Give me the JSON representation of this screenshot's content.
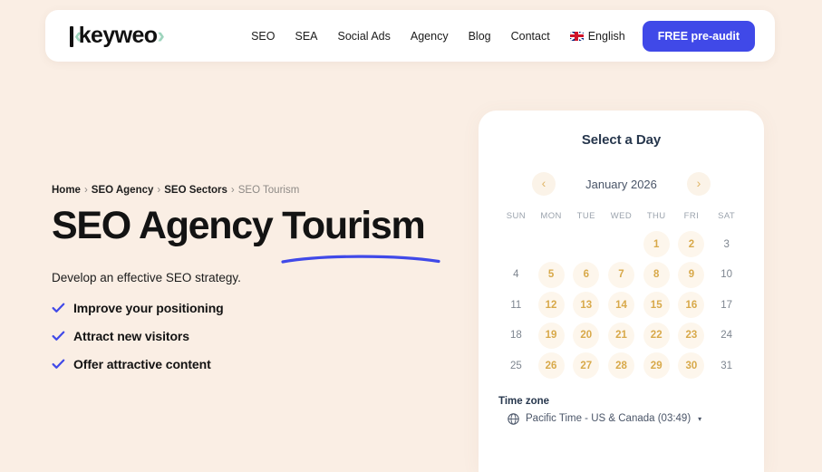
{
  "header": {
    "logo": {
      "text": "keyweo",
      "chevron_left": "‹",
      "chevron_right": "›"
    },
    "nav_items": [
      {
        "label": "SEO"
      },
      {
        "label": "SEA"
      },
      {
        "label": "Social Ads"
      },
      {
        "label": "Agency"
      },
      {
        "label": "Blog"
      },
      {
        "label": "Contact"
      }
    ],
    "language": {
      "label": "English",
      "flag": "uk-flag-icon"
    },
    "cta": {
      "label_strong": "FREE",
      "label_rest": " pre-audit",
      "color": "#4049e8"
    }
  },
  "breadcrumb": {
    "items": [
      {
        "label": "Home",
        "current": false
      },
      {
        "label": "SEO Agency",
        "current": false
      },
      {
        "label": "SEO Sectors",
        "current": false
      },
      {
        "label": "SEO Tourism",
        "current": true
      }
    ],
    "separator": "›"
  },
  "hero": {
    "title": "SEO Agency Tourism",
    "underline_color": "#4049e8",
    "subtitle": "Develop an effective SEO strategy.",
    "features": [
      {
        "label": "Improve your positioning"
      },
      {
        "label": "Attract new visitors"
      },
      {
        "label": "Offer attractive content"
      }
    ],
    "check_color": "#4049e8"
  },
  "calendar": {
    "title": "Select a Day",
    "prev_label": "‹",
    "next_label": "›",
    "month": "January 2026",
    "weekdays": [
      "SUN",
      "MON",
      "TUE",
      "WED",
      "THU",
      "FRI",
      "SAT"
    ],
    "available_color": "#d8a94a",
    "available_bg": "#fdf6ec",
    "weeks": [
      [
        {
          "label": "",
          "available": false,
          "blank": true
        },
        {
          "label": "",
          "available": false,
          "blank": true
        },
        {
          "label": "",
          "available": false,
          "blank": true
        },
        {
          "label": "",
          "available": false,
          "blank": true
        },
        {
          "label": "1",
          "available": true,
          "blank": false
        },
        {
          "label": "2",
          "available": true,
          "blank": false
        },
        {
          "label": "3",
          "available": false,
          "blank": false
        }
      ],
      [
        {
          "label": "4",
          "available": false,
          "blank": false
        },
        {
          "label": "5",
          "available": true,
          "blank": false
        },
        {
          "label": "6",
          "available": true,
          "blank": false
        },
        {
          "label": "7",
          "available": true,
          "blank": false
        },
        {
          "label": "8",
          "available": true,
          "blank": false
        },
        {
          "label": "9",
          "available": true,
          "blank": false
        },
        {
          "label": "10",
          "available": false,
          "blank": false
        }
      ],
      [
        {
          "label": "11",
          "available": false,
          "blank": false
        },
        {
          "label": "12",
          "available": true,
          "blank": false
        },
        {
          "label": "13",
          "available": true,
          "blank": false
        },
        {
          "label": "14",
          "available": true,
          "blank": false
        },
        {
          "label": "15",
          "available": true,
          "blank": false
        },
        {
          "label": "16",
          "available": true,
          "blank": false
        },
        {
          "label": "17",
          "available": false,
          "blank": false
        }
      ],
      [
        {
          "label": "18",
          "available": false,
          "blank": false
        },
        {
          "label": "19",
          "available": true,
          "blank": false
        },
        {
          "label": "20",
          "available": true,
          "blank": false
        },
        {
          "label": "21",
          "available": true,
          "blank": false
        },
        {
          "label": "22",
          "available": true,
          "blank": false
        },
        {
          "label": "23",
          "available": true,
          "blank": false
        },
        {
          "label": "24",
          "available": false,
          "blank": false
        }
      ],
      [
        {
          "label": "25",
          "available": false,
          "blank": false
        },
        {
          "label": "26",
          "available": true,
          "blank": false
        },
        {
          "label": "27",
          "available": true,
          "blank": false
        },
        {
          "label": "28",
          "available": true,
          "blank": false
        },
        {
          "label": "29",
          "available": true,
          "blank": false
        },
        {
          "label": "30",
          "available": true,
          "blank": false
        },
        {
          "label": "31",
          "available": false,
          "blank": false
        }
      ]
    ],
    "timezone": {
      "label": "Time zone",
      "value": "Pacific Time - US & Canada (03:49)",
      "caret": "▾"
    }
  },
  "theme": {
    "page_bg": "#faeee4",
    "card_bg": "#ffffff",
    "accent": "#4049e8",
    "logo_accent": "#9ed4bd"
  }
}
